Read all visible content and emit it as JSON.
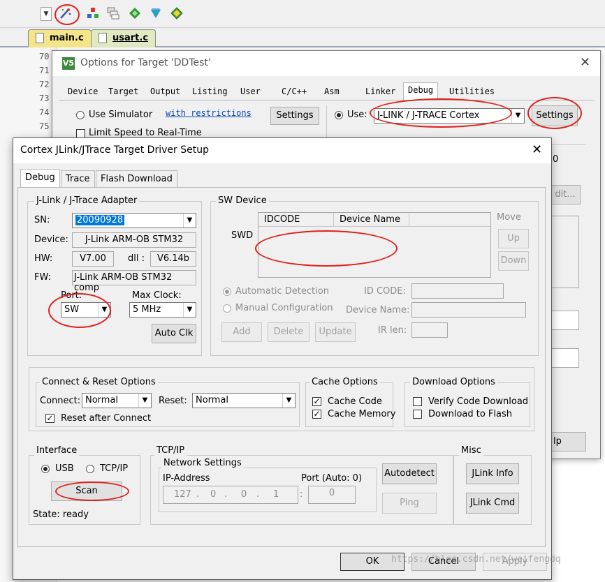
{
  "editor": {
    "file_tabs": [
      "main.c",
      "usart.c"
    ],
    "line_numbers": [
      "70",
      "71",
      "72",
      "73",
      "74",
      "75"
    ]
  },
  "options_dialog": {
    "title": "Options for Target 'DDTest'",
    "tabs": [
      "Device",
      "Target",
      "Output",
      "Listing",
      "User",
      "C/C++",
      "Asm",
      "Linker",
      "Debug",
      "Utilities"
    ],
    "use_simulator_label": "Use Simulator",
    "with_restrictions_link": "with restrictions",
    "settings_left": "Settings",
    "limit_speed_label": "Limit Speed to Real-Time",
    "use_label": "Use:",
    "debugger_value": "J-LINK / J-TRACE Cortex",
    "settings_right": "Settings",
    "edit_fragment": "dit...",
    "help_fragment": "lp",
    "zero_fragment": "0"
  },
  "jlink_dialog": {
    "title": "Cortex JLink/JTrace Target Driver Setup",
    "tabs": [
      "Debug",
      "Trace",
      "Flash Download"
    ],
    "adapter": {
      "group": "J-Link / J-Trace Adapter",
      "sn_label": "SN:",
      "sn_value": "20090928",
      "device_label": "Device:",
      "device_value": "J-Link ARM-OB STM32",
      "hw_label": "HW:",
      "hw_value": "V7.00",
      "dll_label": "dll :",
      "dll_value": "V6.14b",
      "fw_label": "FW:",
      "fw_value": "J-Link ARM-OB STM32 comp",
      "port_label": "Port:",
      "port_value": "SW",
      "maxclock_label": "Max Clock:",
      "maxclock_value": "5 MHz",
      "autoclk_button": "Auto Clk"
    },
    "sw_device": {
      "group": "SW Device",
      "swd_label": "SWD",
      "col_idcode": "IDCODE",
      "col_device_name": "Device Name",
      "move_label": "Move",
      "up_button": "Up",
      "down_button": "Down",
      "auto_detection": "Automatic Detection",
      "manual_config": "Manual Configuration",
      "id_code_label": "ID CODE:",
      "device_name_label": "Device Name:",
      "ir_len_label": "IR len:",
      "add_button": "Add",
      "delete_button": "Delete",
      "update_button": "Update"
    },
    "connect_reset": {
      "group": "Connect & Reset Options",
      "connect_label": "Connect:",
      "connect_value": "Normal",
      "reset_label": "Reset:",
      "reset_value": "Normal",
      "reset_after_connect": "Reset after Connect"
    },
    "cache": {
      "group": "Cache Options",
      "cache_code": "Cache Code",
      "cache_memory": "Cache Memory"
    },
    "download": {
      "group": "Download Options",
      "verify": "Verify Code Download",
      "to_flash": "Download to Flash"
    },
    "interface": {
      "group": "Interface",
      "usb": "USB",
      "tcpip": "TCP/IP",
      "scan_button": "Scan",
      "state": "State: ready"
    },
    "tcpip": {
      "group": "TCP/IP",
      "network_settings": "Network Settings",
      "ip_label": "IP-Address",
      "ip": [
        "127",
        "0",
        "0",
        "1"
      ],
      "port_label": "Port (Auto: 0)",
      "port_value": "0",
      "autodetect_button": "Autodetect",
      "ping_button": "Ping"
    },
    "misc": {
      "group": "Misc",
      "jlink_info_button": "JLink Info",
      "jlink_cmd_button": "JLink Cmd"
    },
    "footer": {
      "ok": "OK",
      "cancel": "Cancel",
      "apply": "Apply"
    }
  },
  "watermark": "https://blog.csdn.net/weifengdq",
  "colors": {
    "annotation_red": "#e0201c",
    "selection_blue": "#0078d7",
    "link_blue": "#0645ad"
  }
}
